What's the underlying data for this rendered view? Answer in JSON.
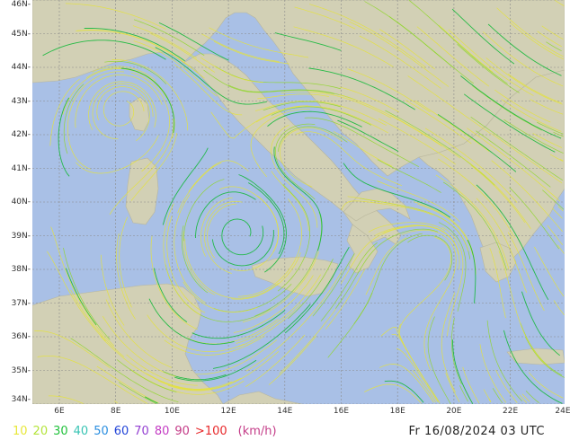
{
  "map": {
    "lat_labels": [
      "46N",
      "45N",
      "44N",
      "43N",
      "42N",
      "41N",
      "40N",
      "39N",
      "38N",
      "37N",
      "36N",
      "35N",
      "34N"
    ],
    "lon_labels": [
      "6E",
      "8E",
      "10E",
      "12E",
      "14E",
      "16E",
      "18E",
      "20E",
      "22E",
      "24E"
    ],
    "colors": {
      "sea": "#a9c0e6",
      "land": "#d2d0b5",
      "grid": "#8a8a8a",
      "streamline_slow": "#e4e23a",
      "streamline_mid": "#8fd62a",
      "streamline_fast": "#14b83a"
    }
  },
  "legend": {
    "items": [
      {
        "label": "10",
        "color": "#e8e83a"
      },
      {
        "label": "20",
        "color": "#b4e43a"
      },
      {
        "label": "30",
        "color": "#22c23c"
      },
      {
        "label": "40",
        "color": "#39c4b4"
      },
      {
        "label": "50",
        "color": "#2a8ee0"
      },
      {
        "label": "60",
        "color": "#2244d8"
      },
      {
        "label": "70",
        "color": "#9440d2"
      },
      {
        "label": "80",
        "color": "#c43cc4"
      },
      {
        "label": "90",
        "color": "#c43c88"
      },
      {
        "label": ">100",
        "color": "#e8282a"
      }
    ],
    "unit": "(km/h)",
    "unit_color": "#c43c88"
  },
  "timestamp": "Fr 16/08/2024 03 UTC"
}
